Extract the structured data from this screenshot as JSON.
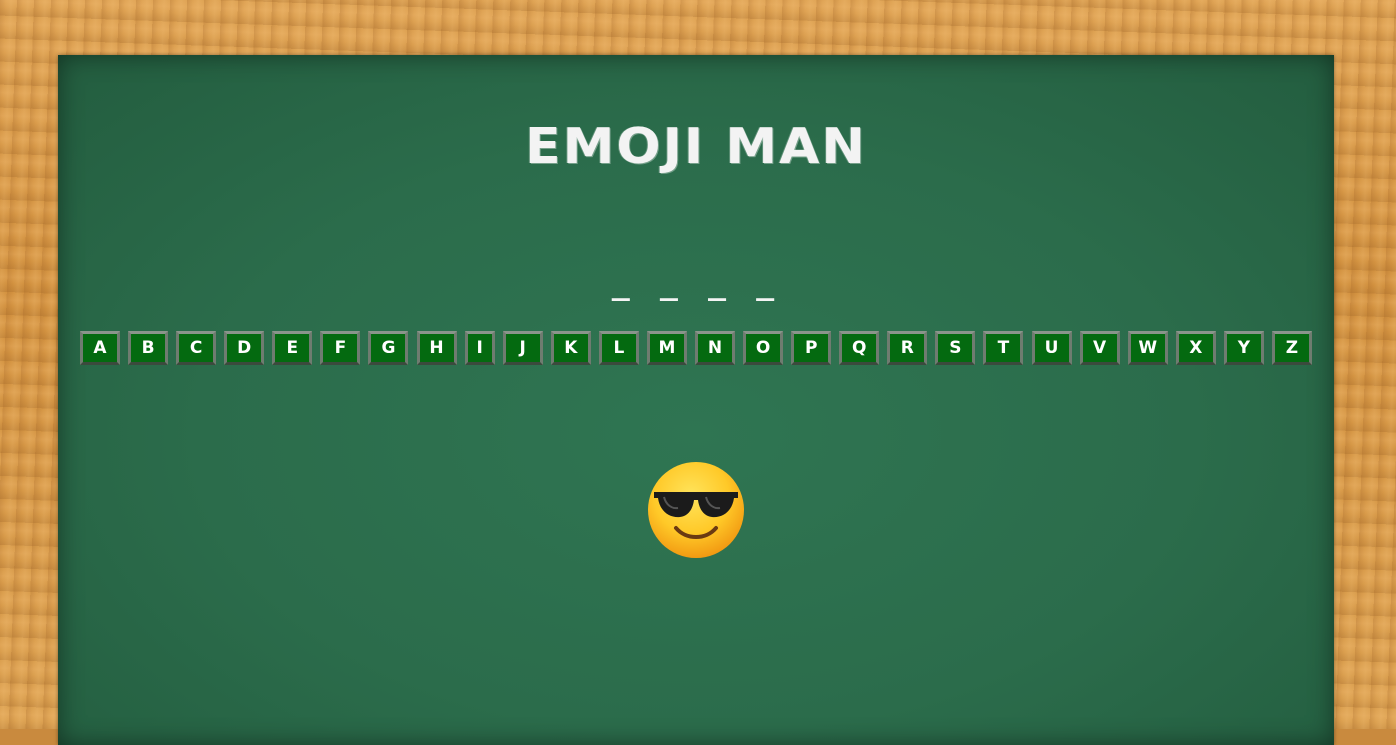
{
  "game": {
    "title": "EMOJI MAN",
    "word_display": "_ _ _ _",
    "letters": [
      "A",
      "B",
      "C",
      "D",
      "E",
      "F",
      "G",
      "H",
      "I",
      "J",
      "K",
      "L",
      "M",
      "N",
      "O",
      "P",
      "Q",
      "R",
      "S",
      "T",
      "U",
      "V",
      "W",
      "X",
      "Y",
      "Z"
    ],
    "emoji_icon": "smiling-face-with-sunglasses-icon"
  },
  "colors": {
    "board": "#2b6c4b",
    "frame": "#d2913f",
    "key_bg": "#046a10",
    "chalk": "#f3f3f3"
  }
}
